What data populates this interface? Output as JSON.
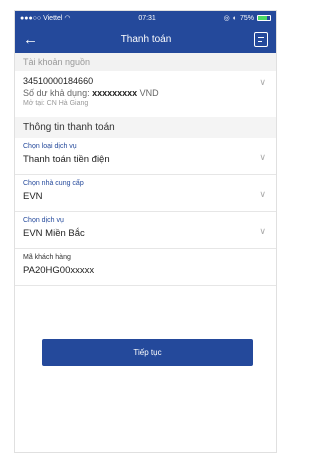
{
  "status_bar": {
    "carrier": "●●●○○ Viettel",
    "time": "07:31",
    "battery_percent": "75%",
    "battery_level": 0.75,
    "battery_color": "#4cd964"
  },
  "nav": {
    "title": "Thanh toán",
    "back_icon": "arrow-left-icon",
    "action_icon": "receipt-icon"
  },
  "source_account": {
    "section_title": "Tài khoản nguồn",
    "account_number": "34510000184660",
    "balance_prefix": "Số dư khả dụng:",
    "balance_masked": "xxxxxxxxx",
    "currency": "VND",
    "branch": "Mở tại: CN Hà Giang"
  },
  "payment_info": {
    "section_title": "Thông tin thanh toán",
    "service_type": {
      "label": "Chọn loại dịch vụ",
      "value": "Thanh toán tiền điện"
    },
    "provider": {
      "label": "Chọn nhà cung cấp",
      "value": "EVN"
    },
    "service": {
      "label": "Chọn dịch vụ",
      "value": "EVN Miền Bắc"
    },
    "customer_code": {
      "label": "Mã khách hàng",
      "value": "PA20HG00xxxxx"
    }
  },
  "continue_button": "Tiếp tục",
  "colors": {
    "primary": "#24499b",
    "label_blue": "#24499b",
    "section_bg": "#f2f2f2"
  }
}
